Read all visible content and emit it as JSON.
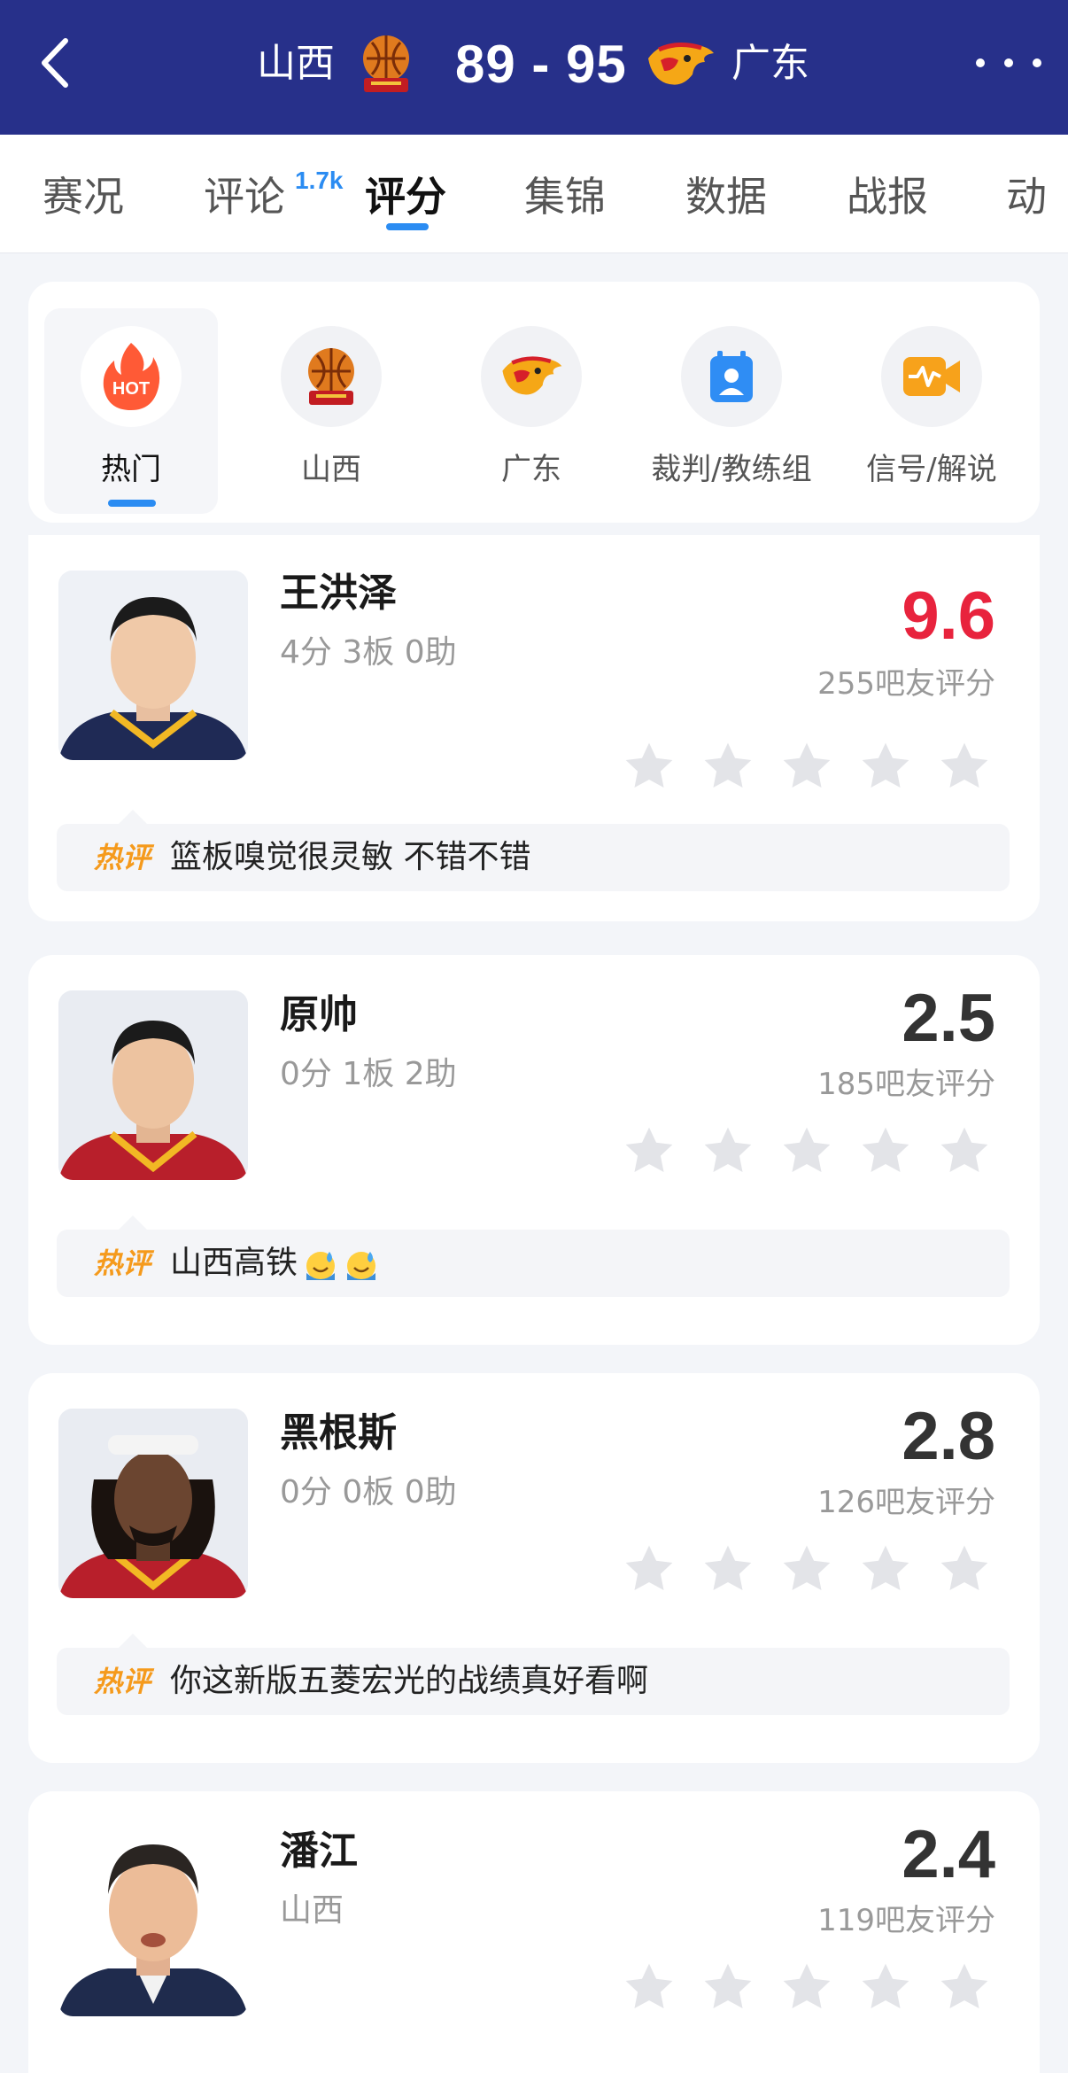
{
  "header": {
    "team_left": "山西",
    "score": "89 - 95",
    "team_right": "广东"
  },
  "tabs": [
    {
      "label": "赛况"
    },
    {
      "label": "评论",
      "badge": "1.7k"
    },
    {
      "label": "评分"
    },
    {
      "label": "集锦"
    },
    {
      "label": "数据"
    },
    {
      "label": "战报"
    },
    {
      "label": "动"
    }
  ],
  "filters": [
    {
      "label": "热门",
      "icon": "hot-icon",
      "icon_text": "HOT"
    },
    {
      "label": "山西",
      "icon": "shanxi-logo-icon"
    },
    {
      "label": "广东",
      "icon": "guangdong-logo-icon"
    },
    {
      "label": "裁判/教练组",
      "icon": "referee-coach-icon"
    },
    {
      "label": "信号/解说",
      "icon": "signal-commentary-icon"
    }
  ],
  "hot_tag_label": "热评",
  "players": [
    {
      "name": "王洪泽",
      "stats": "4分 3板 0助",
      "rating": "9.6",
      "rating_count": "255吧友评分",
      "comment": "篮板嗅觉很灵敏 不错不错"
    },
    {
      "name": "原帅",
      "stats": "0分 1板 2助",
      "rating": "2.5",
      "rating_count": "185吧友评分",
      "comment": "山西高铁"
    },
    {
      "name": "黑根斯",
      "stats": "0分 0板 0助",
      "rating": "2.8",
      "rating_count": "126吧友评分",
      "comment": "你这新版五菱宏光的战绩真好看啊"
    },
    {
      "name": "潘江",
      "stats": "山西",
      "rating": "2.4",
      "rating_count": "119吧友评分"
    }
  ],
  "colors": {
    "header_bg": "#27308a",
    "accent_blue": "#2b8cf2",
    "hot_rating": "#e8233d",
    "hot_tag": "#f59a1c",
    "star_gray": "#e3e4e8"
  }
}
